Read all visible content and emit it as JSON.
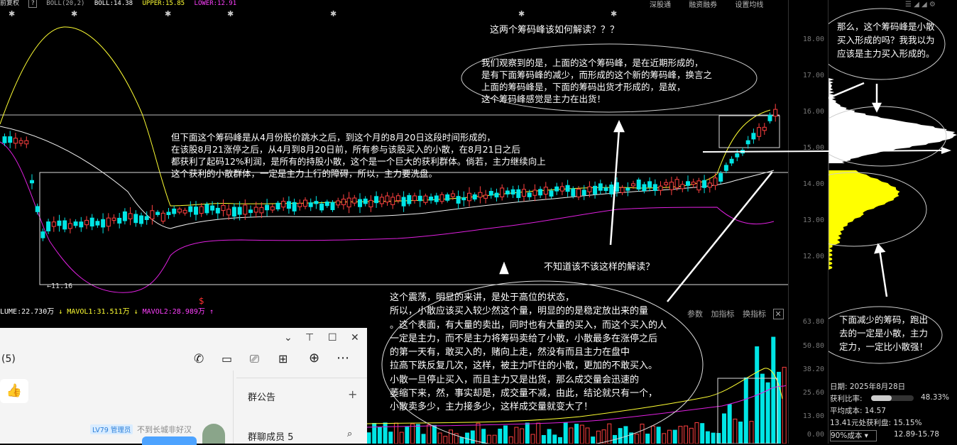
{
  "topbar": {
    "title": "前复权",
    "indicator": "BOLL(20,2)",
    "boll": "BOLL:14.38",
    "upper": "UPPER:15.85",
    "lower": "LOWER:12.91",
    "menu": [
      "深股通",
      "融资融券",
      "设置均线"
    ]
  },
  "price_axis": [
    "18.00",
    "17.00",
    "16.00",
    "15.00",
    "14.00",
    "13.00",
    "12.00"
  ],
  "low_label": "11.16",
  "annotations": {
    "q_title": "这两个筹码峰该如何解读？？？",
    "q_body": "我们观察到的是，上面的这个筹码峰，是在近期形成的，\n是有下面筹码峰的减少，而形成的这个新的筹码峰，换言之\n上面的筹码峰是，下面的筹码出货才形成的，是故，\n这个筹码峰感觉是主力在出货！",
    "left_body": "但下面这个筹码峰是从4月份股价跳水之后，到这个月的8月20日这段时间形成的，\n在该股8月21涨停之后，从4月到8月20日前，所有参与该股买入的小散，在8月21日之后\n都获利了起码12%利润，是所有的持股小散，这个是一个巨大的获利群体。倘若，主力继续向上\n这个获利的小散群体，一定是主力上行的障碍，所以，主力要洗盘。",
    "q2": "不知道该不该这样的解读？",
    "bottom_body": "这个震荡，明显的来讲，是处于高位的状态，\n所以，小散应该买入较少然这个量，明显的的是稳定放出来的量\n。这个表面，有大量的卖出，同时也有大量的买入，而这个买入的人\n一定是主力，而不是主力将筹码卖给了小散，小散最多在涨停之后\n的第一天有，敢买入的，赌向上走，然没有而且主力在盘中\n拉高下跌反复几次，这样，被主力吓住的小散，更加的不敢买入。\n小散一旦停止买入，而且主力又是出货，那么成交量会迅速的\n萎缩下来，然，事实却是，成交量不减，由此，结论就只有一个，\n小散卖多少，主力接多少，这样成交量就变大了！",
    "right_top": "那么，这个筹码峰是小散\n买入形成的吗？我我以为\n应该是主力买入形成的。",
    "right_bottom": "下面减少的筹码，跑出\n去的一定是小散，主力\n定力，一定比小散强！"
  },
  "volume": {
    "volume": "LUME:22.730万",
    "mavol1": "MAVOL1:31.511万",
    "mavol2": "MAVOL2:28.989万",
    "axis": [
      "63.80",
      "50.80",
      "38.20",
      "25.60",
      "13.00",
      "0.00"
    ],
    "tabs": [
      "参数",
      "加指标",
      "换指标"
    ]
  },
  "chat": {
    "group_suffix": "(5)",
    "announcement": "群公告",
    "members": "群聊成员 5",
    "badge": "LV79 管理员",
    "username": "不到长城非好汉"
  },
  "stats": {
    "date": "日期: 2025年8月28日",
    "ratio_label": "获利比率:",
    "ratio_value": "48.33%",
    "ratio": 0.4833,
    "avg_cost": "平均成本: 14.57",
    "profit": "13.41元处获利盘: 15.15%",
    "cost_select": "90%成本",
    "cost_range": "12.89-15.78"
  },
  "colors": {
    "up": "#ff4040",
    "down": "#00e5e5",
    "upper": "#ffff33",
    "mid": "#ffffff",
    "lower": "#e020e0",
    "chips": "#ffff00"
  }
}
